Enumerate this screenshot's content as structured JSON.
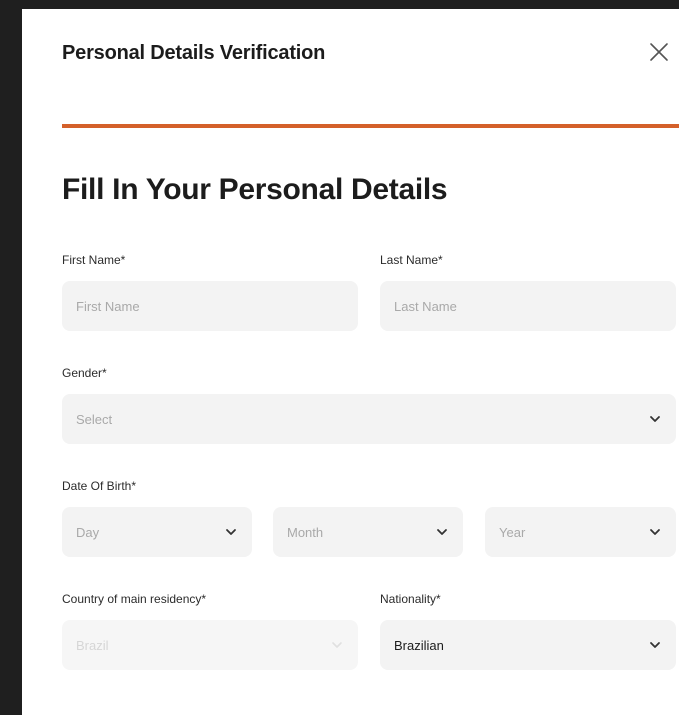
{
  "modal": {
    "title": "Personal Details Verification",
    "close_icon": "close-icon",
    "progress_fraction": 1.0,
    "accent_color": "#d4602a"
  },
  "form": {
    "heading": "Fill In Your Personal Details",
    "first_name": {
      "label": "First Name*",
      "placeholder": "First Name"
    },
    "last_name": {
      "label": "Last Name*",
      "placeholder": "Last Name"
    },
    "gender": {
      "label": "Gender*",
      "placeholder": "Select"
    },
    "dob": {
      "label": "Date Of Birth*",
      "day_placeholder": "Day",
      "month_placeholder": "Month",
      "year_placeholder": "Year"
    },
    "country": {
      "label": "Country of main residency*",
      "value": "Brazil"
    },
    "nationality": {
      "label": "Nationality*",
      "value": "Brazilian"
    }
  }
}
